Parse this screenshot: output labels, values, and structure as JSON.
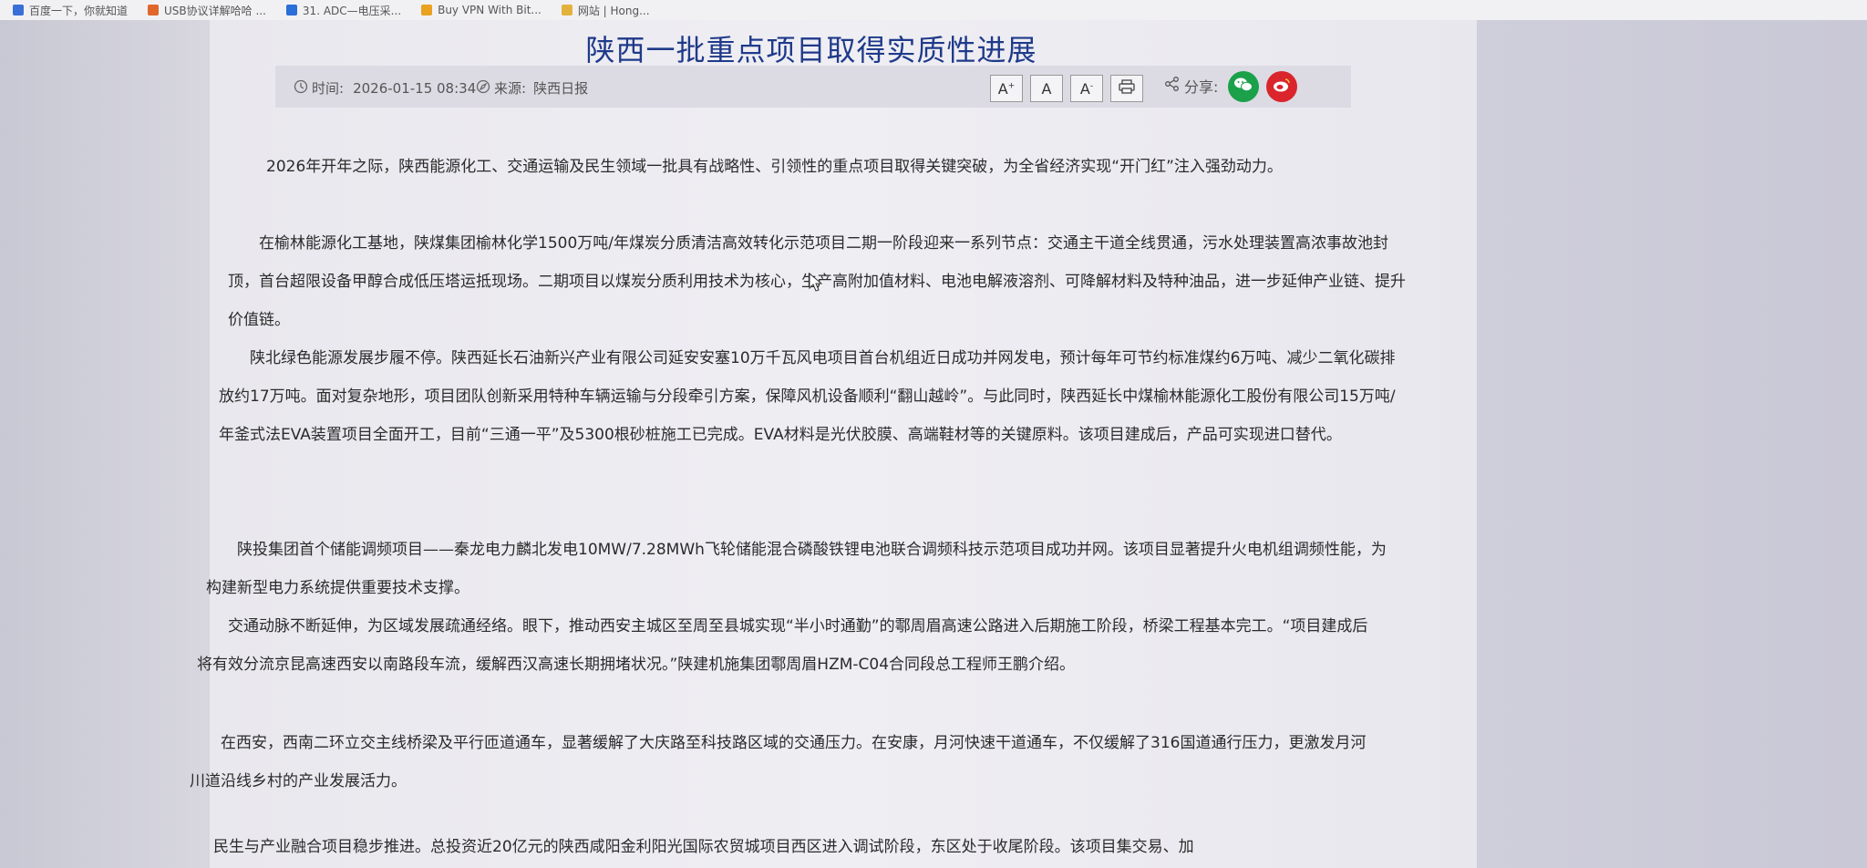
{
  "bookmarks": [
    {
      "label": "百度一下，你就知道",
      "color": "#3b6fd8"
    },
    {
      "label": "USB协议详解哈哈 ...",
      "color": "#e0672b"
    },
    {
      "label": "31. ADC—电压采...",
      "color": "#2a6ed8"
    },
    {
      "label": "Buy VPN With Bit...",
      "color": "#e9a21f"
    },
    {
      "label": "网站 | Hong...",
      "color": "#e3b23c"
    }
  ],
  "article": {
    "title": "陕西一批重点项目取得实质性进展",
    "time_label": "时间:",
    "time_value": "2026-01-15 08:34",
    "source_label": "来源:",
    "source_value": "陕西日报",
    "share_label": "分享:",
    "font_buttons": [
      "A+",
      "A",
      "A-"
    ],
    "paragraphs": [
      "2026年开年之际，陕西能源化工、交通运输及民生领域一批具有战略性、引领性的重点项目取得关键突破，为全省经济实现“开门红”注入强劲动力。",
      "在榆林能源化工基地，陕煤集团榆林化学1500万吨/年煤炭分质清洁高效转化示范项目二期一阶段迎来一系列节点：交通主干道全线贯通，污水处理装置高浓事故池封顶，首台超限设备甲醇合成低压塔运抵现场。二期项目以煤炭分质利用技术为核心，生产高附加值材料、电池电解液溶剂、可降解材料及特种油品，进一步延伸产业链、提升价值链。",
      "陕北绿色能源发展步履不停。陕西延长石油新兴产业有限公司延安安塞10万千瓦风电项目首台机组近日成功并网发电，预计每年可节约标准煤约6万吨、减少二氧化碳排放约17万吨。面对复杂地形，项目团队创新采用特种车辆运输与分段牵引方案，保障风机设备顺利“翻山越岭”。与此同时，陕西延长中煤榆林能源化工股份有限公司15万吨/年釜式法EVA装置项目全面开工，目前“三通一平”及5300根砂桩施工已完成。EVA材料是光伏胶膜、高端鞋材等的关键原料。该项目建成后，产品可实现进口替代。",
      "陕投集团首个储能调频项目——秦龙电力麟北发电10MW/7.28MWh飞轮储能混合磷酸铁锂电池联合调频科技示范项目成功并网。该项目显著提升火电机组调频性能，为构建新型电力系统提供重要技术支撑。",
      "交通动脉不断延伸，为区域发展疏通经络。眼下，推动西安主城区至周至县城实现“半小时通勤”的鄠周眉高速公路进入后期施工阶段，桥梁工程基本完工。“项目建成后将有效分流京昆高速西安以南路段车流，缓解西汉高速长期拥堵状况。”陕建机施集团鄠周眉HZM-C04合同段总工程师王鹏介绍。",
      "在西安，西南二环立交主线桥梁及平行匝道通车，显著缓解了大庆路至科技路区域的交通压力。在安康，月河快速干道通车，不仅缓解了316国道通行压力，更激发月河川道沿线乡村的产业发展活力。",
      "民生与产业融合项目稳步推进。总投资近20亿元的陕西咸阳金利阳光国际农贸城项目西区进入调试阶段，东区处于收尾阶段。该项目集交易、加"
    ]
  },
  "colors": {
    "title": "#1f3a8a",
    "wechat": "#1aa14a",
    "weibo": "#d9252b"
  }
}
